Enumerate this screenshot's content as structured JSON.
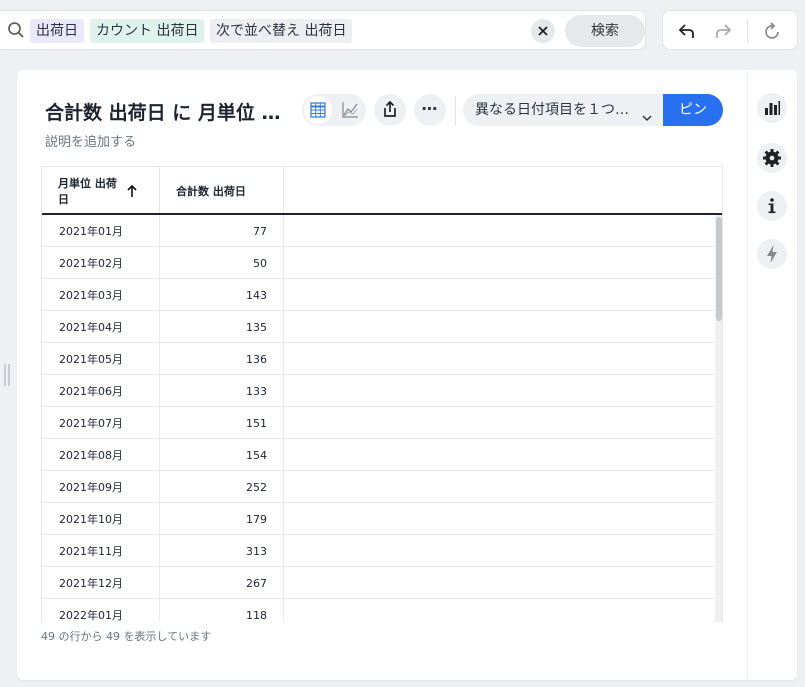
{
  "search": {
    "tokens": [
      "出荷日",
      "カウント 出荷日",
      "次で並べ替え 出荷日"
    ],
    "search_label": "検索",
    "clear_icon": "close-icon"
  },
  "history": {
    "undo_icon": "undo-icon",
    "redo_icon": "redo-icon",
    "reset_icon": "reset-icon"
  },
  "card": {
    "title": "合計数 出荷日 に 月単位 出荷日",
    "description": "説明を追加する",
    "more_label": "⋯",
    "date_select": "異なる日付項目を１つ…",
    "pin_label": "ピン"
  },
  "side_panel": {
    "icons": [
      "bar-chart-icon",
      "gear-icon",
      "info-icon",
      "lightning-icon"
    ]
  },
  "table": {
    "columns": [
      "月単位 出荷日",
      "合計数 出荷日"
    ],
    "sort_direction": "ascending",
    "rows": [
      {
        "date": "2021年01月",
        "value": "77"
      },
      {
        "date": "2021年02月",
        "value": "50"
      },
      {
        "date": "2021年03月",
        "value": "143"
      },
      {
        "date": "2021年04月",
        "value": "135"
      },
      {
        "date": "2021年05月",
        "value": "136"
      },
      {
        "date": "2021年06月",
        "value": "133"
      },
      {
        "date": "2021年07月",
        "value": "151"
      },
      {
        "date": "2021年08月",
        "value": "154"
      },
      {
        "date": "2021年09月",
        "value": "252"
      },
      {
        "date": "2021年10月",
        "value": "179"
      },
      {
        "date": "2021年11月",
        "value": "313"
      },
      {
        "date": "2021年12月",
        "value": "267"
      },
      {
        "date": "2022年01月",
        "value": "118"
      }
    ],
    "footer": "49 の行から 49 を表示しています"
  },
  "colors": {
    "accent": "#2770ef",
    "token_purple": "#ece8fb",
    "token_green": "#dff3ec",
    "token_gray": "#eceef2"
  }
}
